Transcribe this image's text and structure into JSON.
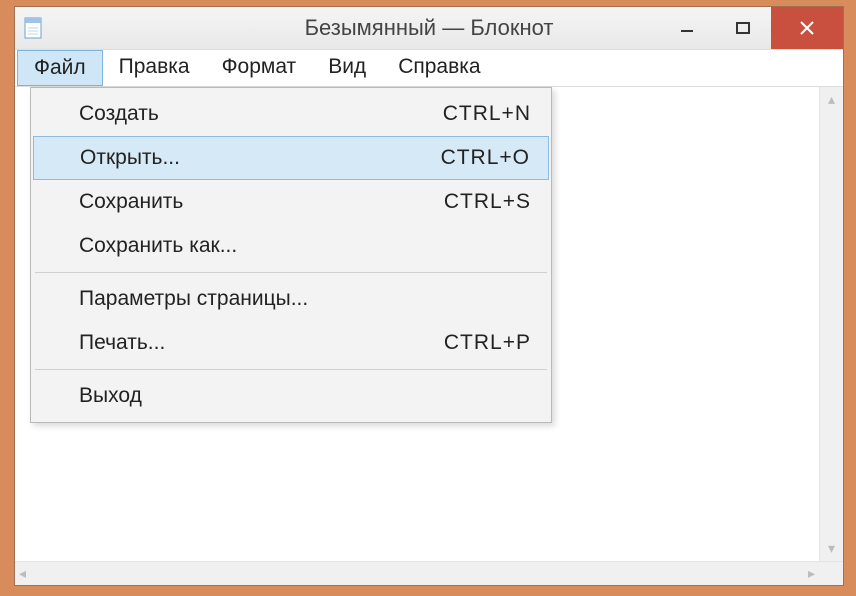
{
  "window": {
    "title": "Безымянный — Блокнот"
  },
  "menubar": {
    "items": [
      {
        "label": "Файл",
        "active": true
      },
      {
        "label": "Правка",
        "active": false
      },
      {
        "label": "Формат",
        "active": false
      },
      {
        "label": "Вид",
        "active": false
      },
      {
        "label": "Справка",
        "active": false
      }
    ]
  },
  "dropdown": {
    "groups": [
      [
        {
          "label": "Создать",
          "shortcut": "CTRL+N",
          "hover": false
        },
        {
          "label": "Открыть...",
          "shortcut": "CTRL+O",
          "hover": true
        },
        {
          "label": "Сохранить",
          "shortcut": "CTRL+S",
          "hover": false
        },
        {
          "label": "Сохранить как...",
          "shortcut": "",
          "hover": false
        }
      ],
      [
        {
          "label": "Параметры страницы...",
          "shortcut": "",
          "hover": false
        },
        {
          "label": "Печать...",
          "shortcut": "CTRL+P",
          "hover": false
        }
      ],
      [
        {
          "label": "Выход",
          "shortcut": "",
          "hover": false
        }
      ]
    ]
  }
}
